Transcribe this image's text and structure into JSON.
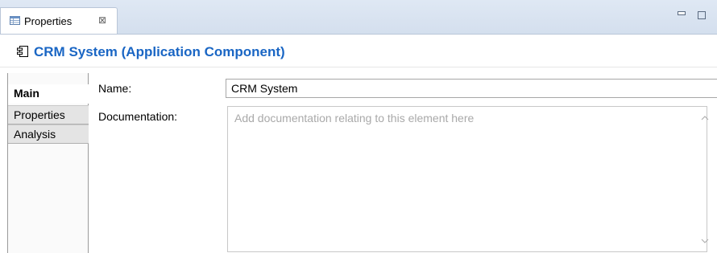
{
  "view_tab": {
    "label": "Properties",
    "close_glyph": "⊠"
  },
  "header": {
    "title": "CRM System (Application Component)"
  },
  "side_tabs": [
    {
      "label": "Main"
    },
    {
      "label": "Properties"
    },
    {
      "label": "Analysis"
    }
  ],
  "form": {
    "name_label": "Name:",
    "name_value": "CRM System",
    "documentation_label": "Documentation:",
    "documentation_placeholder": "Add documentation relating to this element here"
  },
  "colors": {
    "title": "#1a66c4",
    "tabbar": "#d4dfee"
  }
}
